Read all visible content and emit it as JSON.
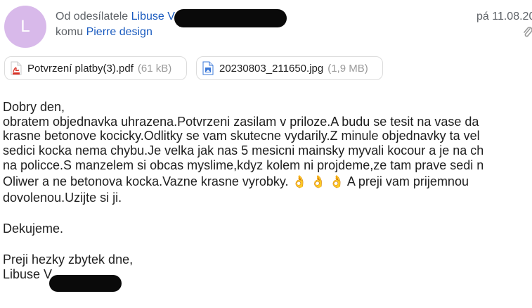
{
  "header": {
    "avatar_letter": "L",
    "from_prefix": "Od odesílatele",
    "from_name": "Libuse V",
    "to_prefix": "komu",
    "to_name": "Pierre design",
    "date": "pá 11.08.20"
  },
  "attachments": [
    {
      "name": "Potvrzení platby(3).pdf",
      "size": "(61 kB)",
      "icon": "pdf-file-icon"
    },
    {
      "name": "20230803_211650.jpg",
      "size": "(1,9 MB)",
      "icon": "image-file-icon"
    }
  ],
  "body": {
    "lines": [
      "Dobry den,",
      "obratem objednavka uhrazena.Potvrzeni zasilam v priloze.A budu se tesit na vase da",
      "krasne betonove kocicky.Odlitky se vam skutecne vydarily.Z minule objednavky ta vel",
      "sedici kocka nema chybu.Je velka jak nas 5 mesicni mainsky myvali kocour a je na ch",
      "na policce.S manzelem si obcas myslime,kdyz kolem ni projdeme,ze tam prave sedi n",
      "Oliwer a ne betonova kocka.Vazne krasne vyrobky.",
      "A preji vam prijemnou",
      "dovolenou.Uzijte si ji.",
      "Dekujeme.",
      "Preji hezky zbytek dne,",
      "Libuse V"
    ],
    "emoji": "👌 👌 👌"
  }
}
